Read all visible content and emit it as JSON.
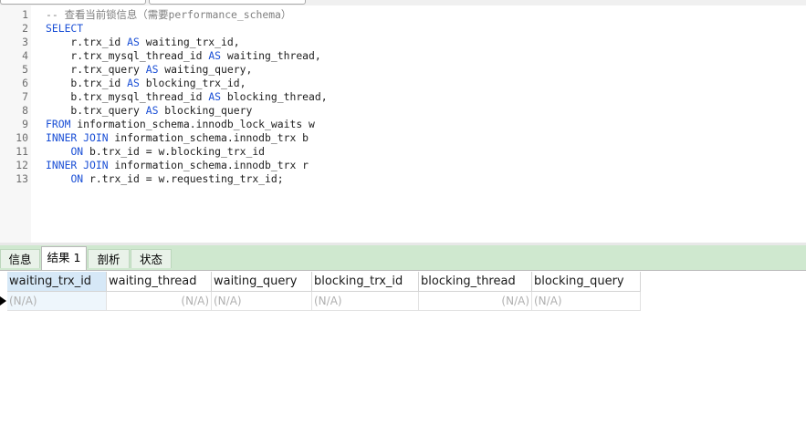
{
  "editor": {
    "lines": [
      {
        "num": "1",
        "parts": [
          {
            "t": "-- 查看当前锁信息（需要performance_schema）",
            "c": "cm"
          }
        ]
      },
      {
        "num": "2",
        "parts": [
          {
            "t": "SELECT",
            "c": "kw"
          }
        ]
      },
      {
        "num": "3",
        "parts": [
          {
            "t": "    r.trx_id ",
            "c": ""
          },
          {
            "t": "AS",
            "c": "kw"
          },
          {
            "t": " waiting_trx_id,",
            "c": ""
          }
        ]
      },
      {
        "num": "4",
        "parts": [
          {
            "t": "    r.trx_mysql_thread_id ",
            "c": ""
          },
          {
            "t": "AS",
            "c": "kw"
          },
          {
            "t": " waiting_thread,",
            "c": ""
          }
        ]
      },
      {
        "num": "5",
        "parts": [
          {
            "t": "    r.trx_query ",
            "c": ""
          },
          {
            "t": "AS",
            "c": "kw"
          },
          {
            "t": " waiting_query,",
            "c": ""
          }
        ]
      },
      {
        "num": "6",
        "parts": [
          {
            "t": "    b.trx_id ",
            "c": ""
          },
          {
            "t": "AS",
            "c": "kw"
          },
          {
            "t": " blocking_trx_id,",
            "c": ""
          }
        ]
      },
      {
        "num": "7",
        "parts": [
          {
            "t": "    b.trx_mysql_thread_id ",
            "c": ""
          },
          {
            "t": "AS",
            "c": "kw"
          },
          {
            "t": " blocking_thread,",
            "c": ""
          }
        ]
      },
      {
        "num": "8",
        "parts": [
          {
            "t": "    b.trx_query ",
            "c": ""
          },
          {
            "t": "AS",
            "c": "kw"
          },
          {
            "t": " blocking_query",
            "c": ""
          }
        ]
      },
      {
        "num": "9",
        "parts": [
          {
            "t": "FROM",
            "c": "kw"
          },
          {
            "t": " information_schema.innodb_lock_waits w",
            "c": ""
          }
        ]
      },
      {
        "num": "10",
        "parts": [
          {
            "t": "INNER JOIN",
            "c": "kw"
          },
          {
            "t": " information_schema.innodb_trx b",
            "c": ""
          }
        ]
      },
      {
        "num": "11",
        "parts": [
          {
            "t": "    ",
            "c": ""
          },
          {
            "t": "ON",
            "c": "kw"
          },
          {
            "t": " b.trx_id = w.blocking_trx_id",
            "c": ""
          }
        ]
      },
      {
        "num": "12",
        "parts": [
          {
            "t": "INNER JOIN",
            "c": "kw"
          },
          {
            "t": " information_schema.innodb_trx r",
            "c": ""
          }
        ]
      },
      {
        "num": "13",
        "parts": [
          {
            "t": "    ",
            "c": ""
          },
          {
            "t": "ON",
            "c": "kw"
          },
          {
            "t": " r.trx_id = w.requesting_trx_id;",
            "c": ""
          }
        ]
      }
    ]
  },
  "tabs": [
    {
      "label": "信息",
      "active": false
    },
    {
      "label": "结果 1",
      "active": true
    },
    {
      "label": "剖析",
      "active": false
    },
    {
      "label": "状态",
      "active": false
    }
  ],
  "results": {
    "columns": [
      "waiting_trx_id",
      "waiting_thread",
      "waiting_query",
      "blocking_trx_id",
      "blocking_thread",
      "blocking_query"
    ],
    "row": [
      "(N/A)",
      "(N/A)",
      "(N/A)",
      "(N/A)",
      "(N/A)",
      "(N/A)"
    ]
  },
  "colors": {
    "keyword": "#1a4fd6",
    "comment": "#7f7f7f",
    "tabbar": "#cfe8cf",
    "selected_header": "#d6e8f7"
  }
}
